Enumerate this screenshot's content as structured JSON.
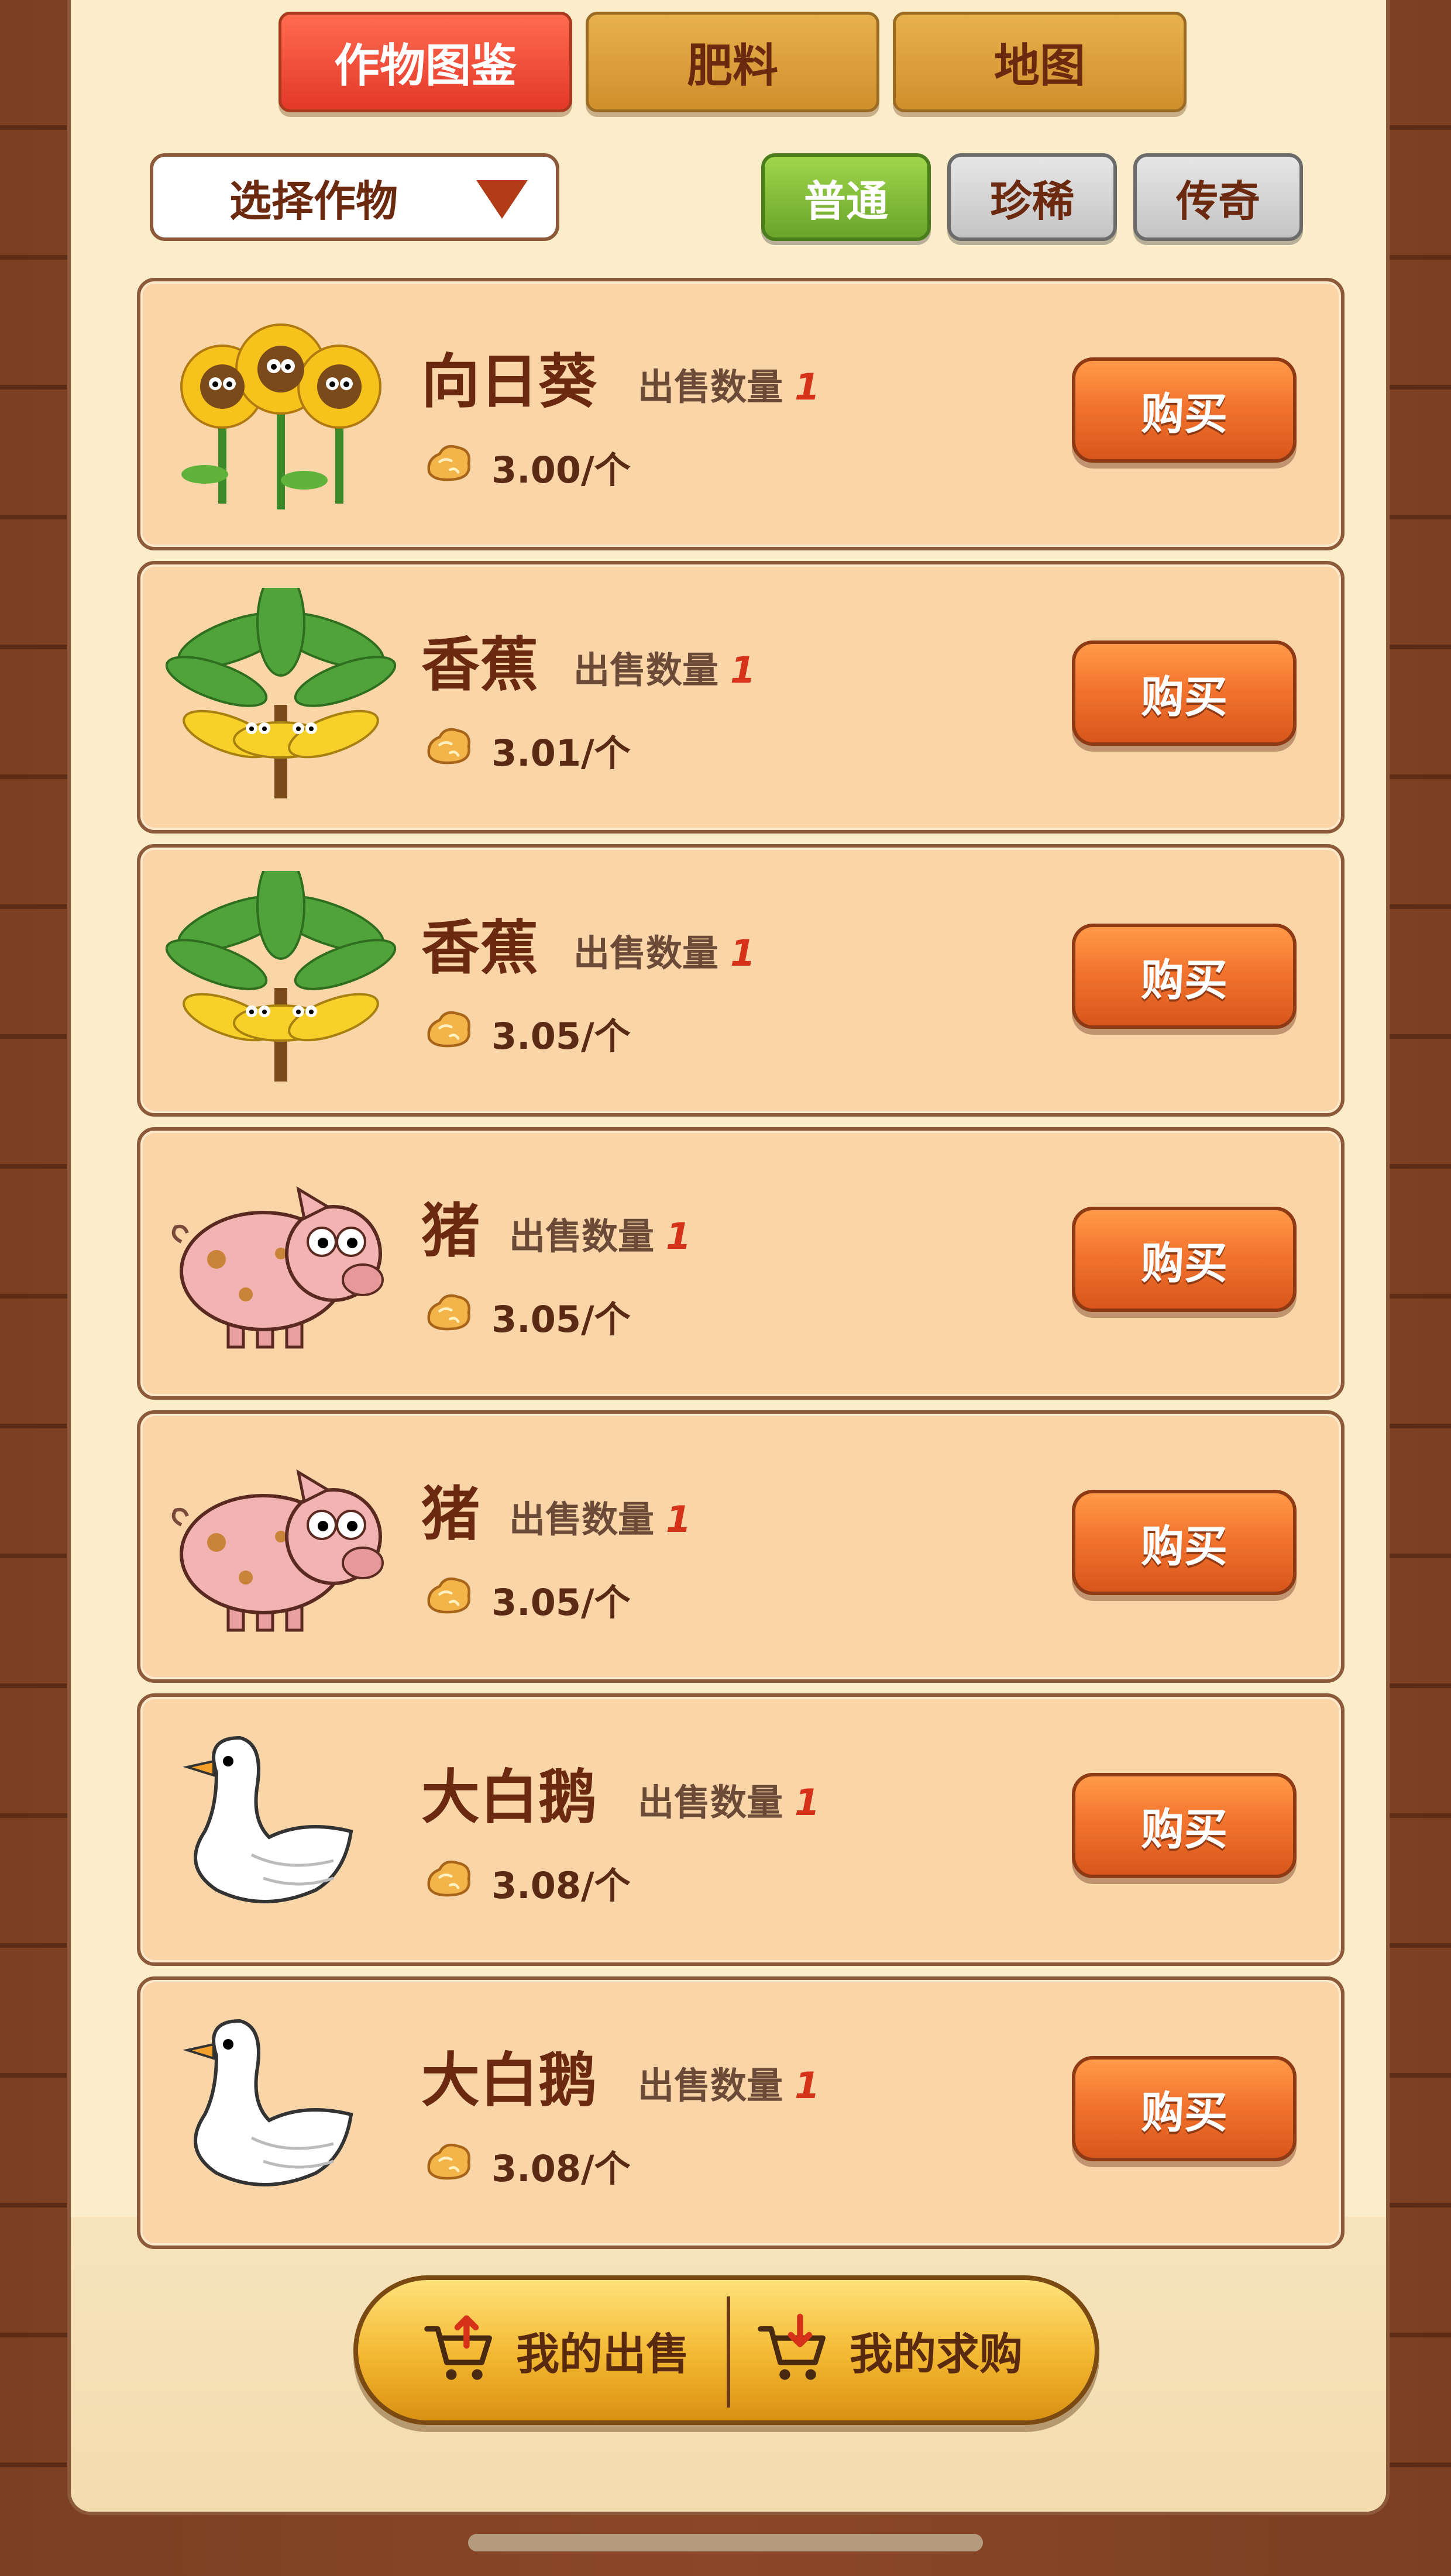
{
  "tabs": [
    {
      "label": "作物图鉴",
      "active": true
    },
    {
      "label": "肥料",
      "active": false
    },
    {
      "label": "地图",
      "active": false
    }
  ],
  "filter": {
    "select_label": "选择作物"
  },
  "rarity": [
    {
      "label": "普通",
      "active": true
    },
    {
      "label": "珍稀",
      "active": false
    },
    {
      "label": "传奇",
      "active": false
    }
  ],
  "listings": [
    {
      "name": "向日葵",
      "art": "sunflower",
      "qty_label": "出售数量",
      "qty": "1",
      "price": "3.00/个",
      "buy_label": "购买"
    },
    {
      "name": "香蕉",
      "art": "banana",
      "qty_label": "出售数量",
      "qty": "1",
      "price": "3.01/个",
      "buy_label": "购买"
    },
    {
      "name": "香蕉",
      "art": "banana",
      "qty_label": "出售数量",
      "qty": "1",
      "price": "3.05/个",
      "buy_label": "购买"
    },
    {
      "name": "猪",
      "art": "pig",
      "qty_label": "出售数量",
      "qty": "1",
      "price": "3.05/个",
      "buy_label": "购买"
    },
    {
      "name": "猪",
      "art": "pig",
      "qty_label": "出售数量",
      "qty": "1",
      "price": "3.05/个",
      "buy_label": "购买"
    },
    {
      "name": "大白鹅",
      "art": "goose",
      "qty_label": "出售数量",
      "qty": "1",
      "price": "3.08/个",
      "buy_label": "购买"
    },
    {
      "name": "大白鹅",
      "art": "goose",
      "qty_label": "出售数量",
      "qty": "1",
      "price": "3.08/个",
      "buy_label": "购买"
    }
  ],
  "bottom_bar": {
    "my_sales": "我的出售",
    "my_requests": "我的求购"
  },
  "icons": {
    "coin": "gold-nugget-icon",
    "cart_up": "cart-upload-icon",
    "cart_down": "cart-download-icon"
  },
  "colors": {
    "accent_red": "#e3382a",
    "buy_orange": "#f3742e",
    "gold": "#f3b730",
    "card_bg": "#f9d5a8",
    "text_brown": "#6b2a10"
  }
}
